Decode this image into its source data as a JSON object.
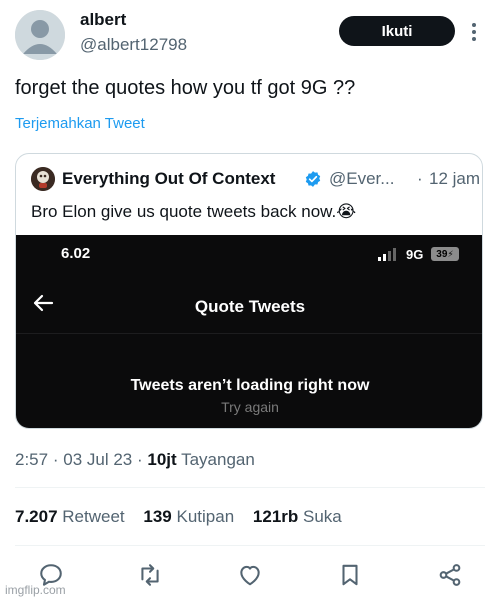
{
  "author": {
    "name": "albert",
    "handle": "@albert12798",
    "follow_label": "Ikuti"
  },
  "tweet": {
    "text": "forget the quotes how you tf got 9G ??",
    "translate_label": "Terjemahkan Tweet"
  },
  "quote": {
    "name": "Everything Out Of Context",
    "handle": "@Ever...",
    "separator": "·",
    "time": "12 jam",
    "text": "Bro Elon give us quote tweets back now.😭",
    "screenshot": {
      "clock": "6.02",
      "network": "9G",
      "battery": "39",
      "title": "Quote Tweets",
      "message": "Tweets aren’t loading right now",
      "retry": "Try again"
    }
  },
  "meta": {
    "time": "2:57",
    "sep": "·",
    "date": "03 Jul 23",
    "views_count": "10jt",
    "views_label": "Tayangan"
  },
  "stats": {
    "retweets_count": "7.207",
    "retweets_label": "Retweet",
    "quotes_count": "139",
    "quotes_label": "Kutipan",
    "likes_count": "121rb",
    "likes_label": "Suka"
  },
  "actions": [
    "reply-icon",
    "retweet-icon",
    "like-icon",
    "bookmark-icon",
    "share-icon"
  ],
  "watermark": "imgflip.com",
  "colors": {
    "link": "#1d9bf0",
    "muted": "#536471",
    "text": "#0f1419",
    "verified": "#1d9bf0"
  }
}
